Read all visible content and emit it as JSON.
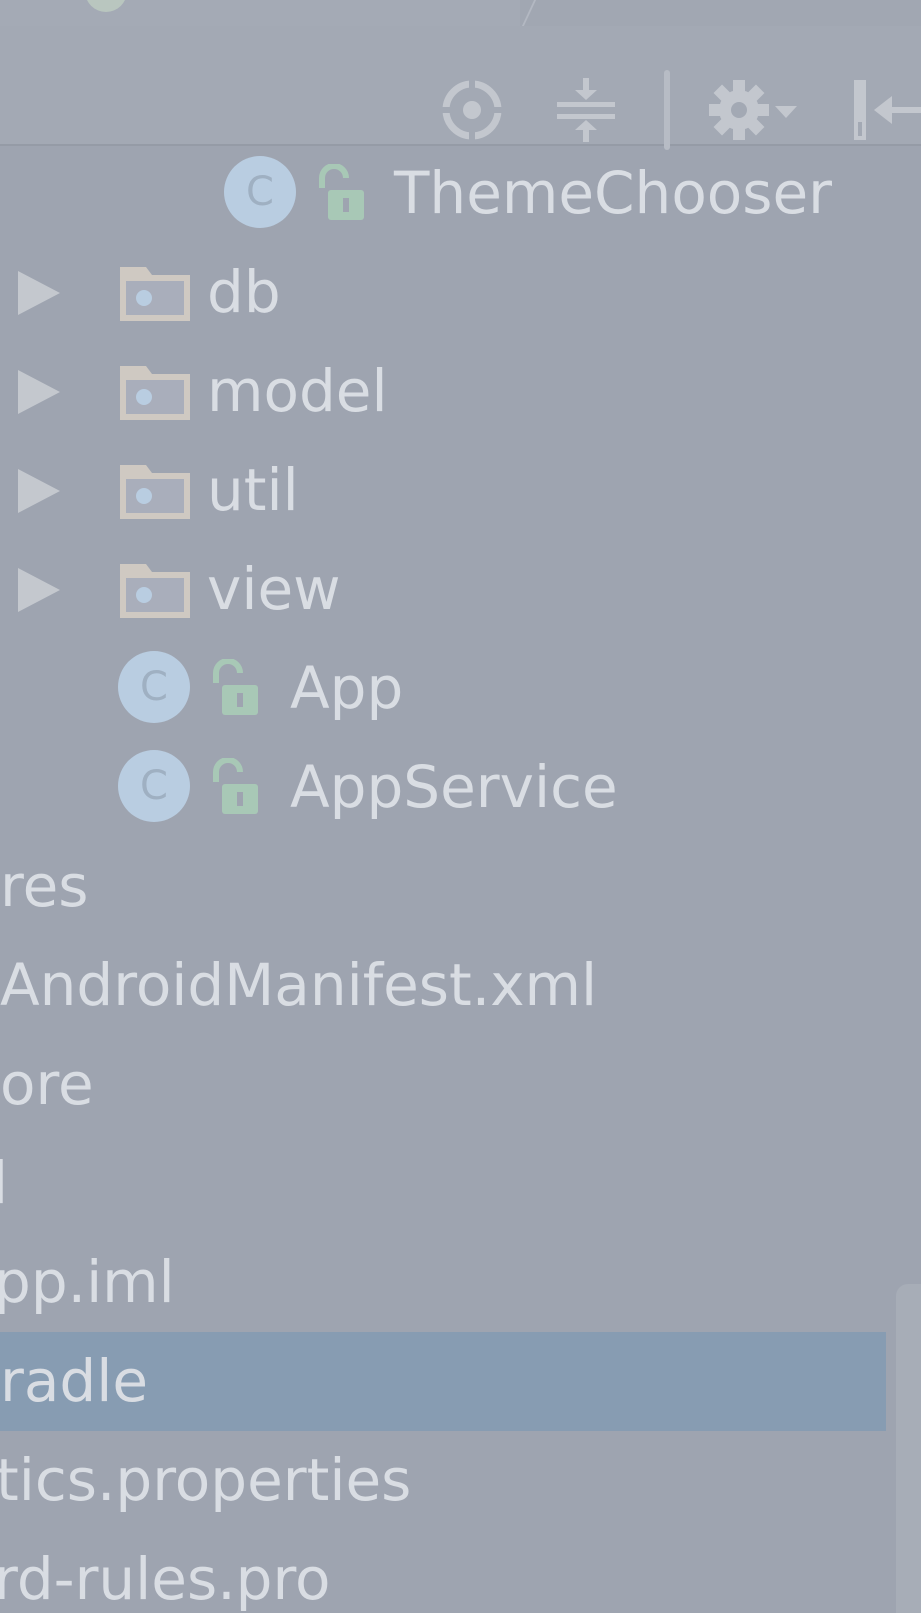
{
  "toolbar": {
    "icons": [
      "crosshair-icon",
      "collapse-all-icon",
      "gear-icon",
      "hide-panel-icon"
    ]
  },
  "tree": {
    "items": [
      {
        "label": "ThemeChooser",
        "kind": "class"
      },
      {
        "label": "db",
        "kind": "package"
      },
      {
        "label": "model",
        "kind": "package"
      },
      {
        "label": "util",
        "kind": "package"
      },
      {
        "label": "view",
        "kind": "package"
      },
      {
        "label": "App",
        "kind": "class"
      },
      {
        "label": "AppService",
        "kind": "class"
      },
      {
        "label": "res",
        "kind": "folder"
      },
      {
        "label": "AndroidManifest.xml",
        "kind": "file"
      },
      {
        "label": "ore",
        "kind": "file"
      },
      {
        "label": "l",
        "kind": "file"
      },
      {
        "label": "pp.iml",
        "kind": "file"
      },
      {
        "label": "radle",
        "kind": "file",
        "selected": true
      },
      {
        "label": "tics.properties",
        "kind": "file"
      },
      {
        "label": "rd-rules.pro",
        "kind": "file"
      }
    ],
    "class_icon_letter": "C"
  },
  "colors": {
    "background": "#9ea4b0",
    "selection": "#879cb2",
    "text": "#d9dde3",
    "class_icon": "#b9cde1",
    "lock": "#a8c8b6",
    "folder": "#cfc9c2"
  }
}
